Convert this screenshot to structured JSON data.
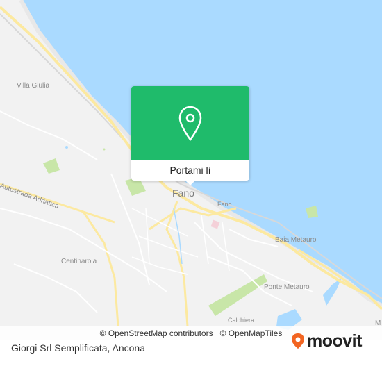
{
  "map": {
    "city": "Fano",
    "labels": {
      "villa_giulia": "Villa Giulia",
      "autostrada": "Autostrada Adriatica",
      "centinarola": "Centinarola",
      "baia_metauro": "Baia Metauro",
      "ponte_metauro": "Ponte Metauro",
      "fano_station": "Fano",
      "m_edge": "M",
      "calchiera": "Calchiera"
    },
    "colors": {
      "sea": "#aadaff",
      "land": "#f2f2f2",
      "road_major": "#fce9a0",
      "road_minor": "#ffffff",
      "park": "#c8e6a8",
      "accent": "#1fbb6b"
    }
  },
  "popup": {
    "button_label": "Portami lì",
    "icon": "location-pin-icon"
  },
  "attribution": {
    "osm": "© OpenStreetMap contributors",
    "omt": "© OpenMapTiles"
  },
  "footer": {
    "title": "Giorgi Srl Semplificata, Ancona",
    "brand": "moovit",
    "brand_icon": "moovit-logo-icon",
    "brand_color": "#f26522"
  }
}
